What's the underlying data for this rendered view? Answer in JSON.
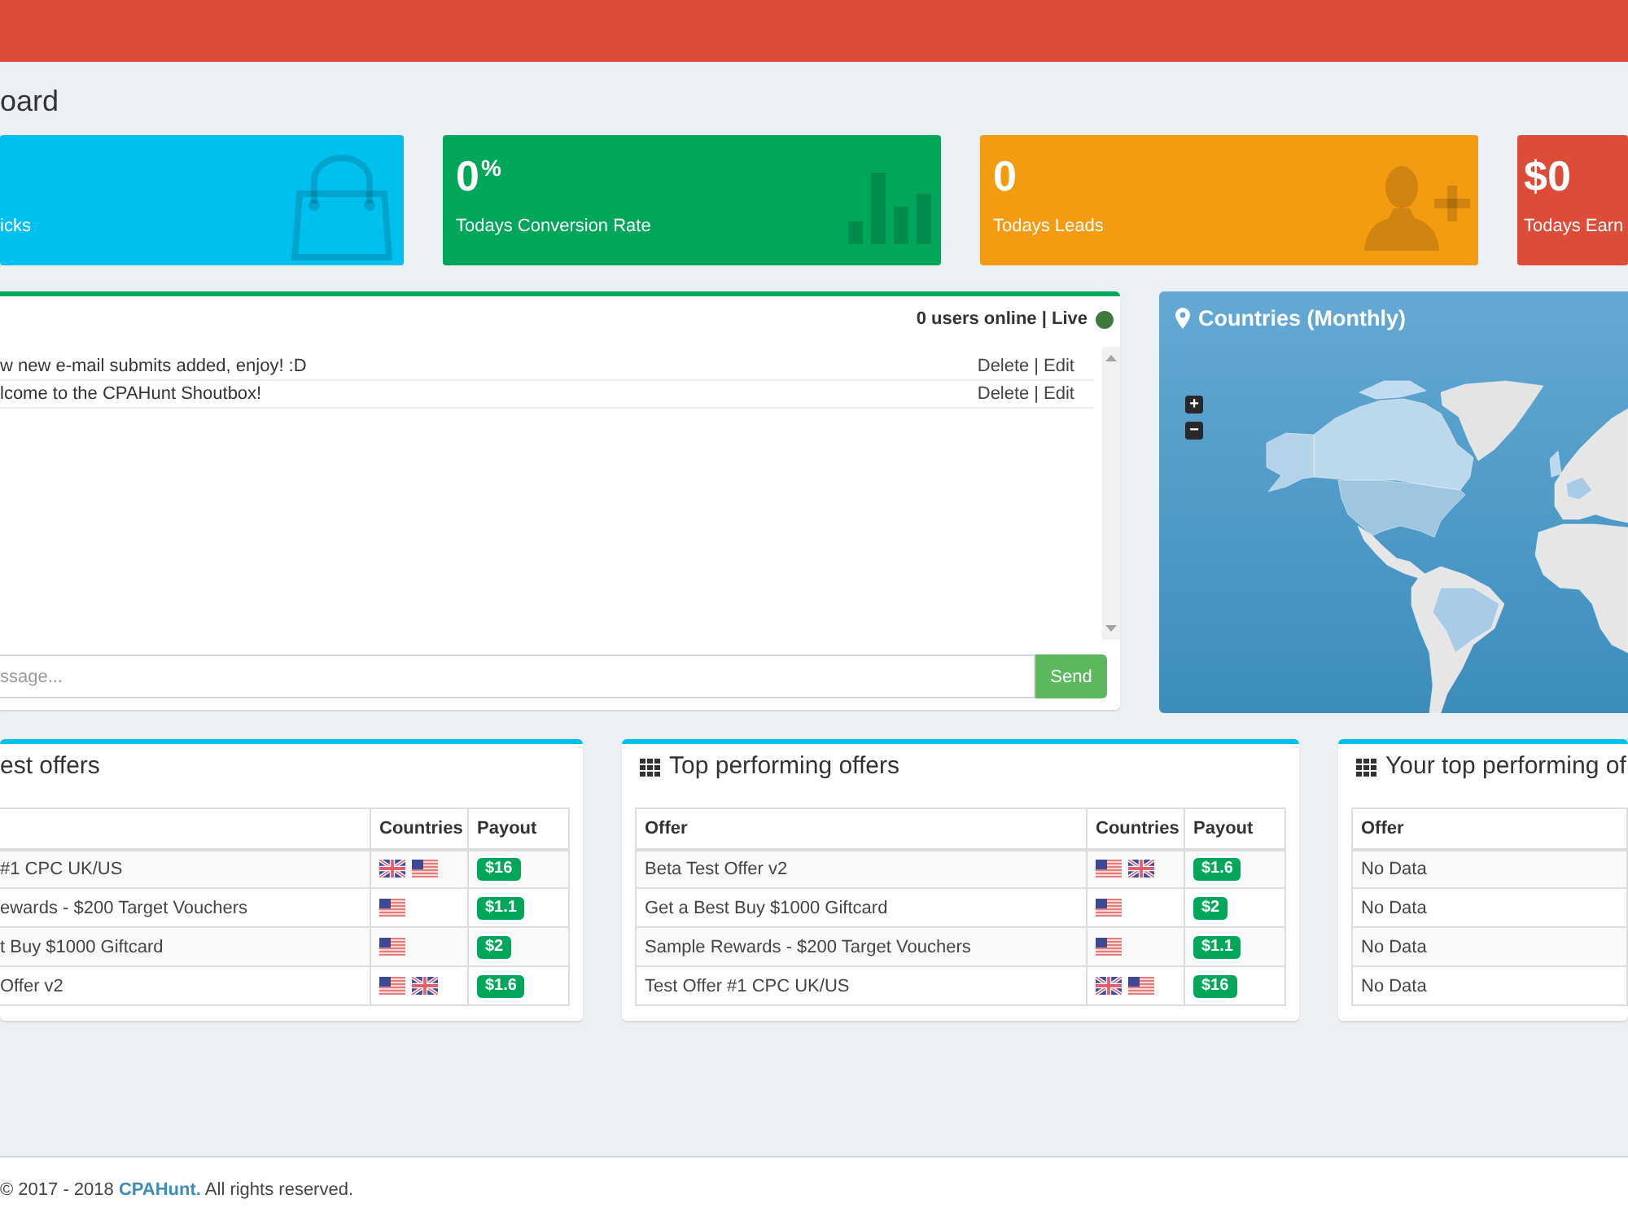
{
  "page_title": "oard",
  "stat_cards": [
    {
      "label": "icks",
      "color": "#00c0ef"
    },
    {
      "value": "0$^{%}$",
      "label": "Todays Conversion Rate",
      "color": "#00a65a"
    },
    {
      "value": "0",
      "label": "Todays Leads",
      "color": "#f39c12"
    },
    {
      "value": "$0",
      "label": "Todays Earn",
      "color": "#dd4b39"
    }
  ],
  "shoutbox": {
    "status": "0 users online | Live",
    "live": true,
    "messages": [
      {
        "text": "w new e-mail submits added, enjoy! :D",
        "delete": "Delete",
        "separator": "|",
        "edit": "Edit"
      },
      {
        "text": "lcome to the CPAHunt Shoutbox!",
        "delete": "Delete",
        "separator": "|",
        "edit": "Edit"
      }
    ],
    "input": {
      "placeholder": "ssage..."
    },
    "send": "Send"
  },
  "map": {
    "title": "Countries (Monthly)",
    "zoom_buttons": [
      "+",
      "−"
    ]
  },
  "offer_panels": [
    {
      "title": "est offers",
      "table": {
        "columns": [
          {
            "kind": "offer"
          },
          {
            "kind": "countries",
            "label": "Countries"
          },
          {
            "kind": "payout",
            "label": "Payout"
          }
        ],
        "rows": [
          {
            "offer": "#1 CPC UK/US",
            "flags": [
              {
                "kind": "uk"
              },
              {
                "kind": "us"
              }
            ],
            "payout": "$16"
          },
          {
            "offer": "ewards - $200 Target Vouchers",
            "flags": [
              {
                "kind": "us"
              }
            ],
            "payout": "$1.1"
          },
          {
            "offer": "t Buy $1000 Giftcard",
            "flags": [
              {
                "kind": "us"
              }
            ],
            "payout": "$2"
          },
          {
            "offer": "Offer v2",
            "flags": [
              {
                "kind": "us"
              },
              {
                "kind": "uk"
              }
            ],
            "payout": "$1.6"
          }
        ]
      }
    },
    {
      "title": "Top performing offers",
      "table": {
        "columns": [
          {
            "kind": "offer",
            "label": "Offer"
          },
          {
            "kind": "countries",
            "label": "Countries"
          },
          {
            "kind": "payout",
            "label": "Payout"
          }
        ],
        "rows": [
          {
            "offer": "Beta Test Offer v2",
            "flags": [
              {
                "kind": "us"
              },
              {
                "kind": "uk"
              }
            ],
            "payout": "$1.6"
          },
          {
            "offer": "Get a Best Buy $1000 Giftcard",
            "flags": [
              {
                "kind": "us"
              }
            ],
            "payout": "$2"
          },
          {
            "offer": "Sample Rewards - $200 Target Vouchers",
            "flags": [
              {
                "kind": "us"
              }
            ],
            "payout": "$1.1"
          },
          {
            "offer": "Test Offer #1 CPC UK/US",
            "flags": [
              {
                "kind": "uk"
              },
              {
                "kind": "us"
              }
            ],
            "payout": "$16"
          }
        ]
      }
    },
    {
      "title": "Your top performing of",
      "table": {
        "columns": [
          {
            "kind": "offer",
            "label": "Offer"
          }
        ],
        "rows": [
          {
            "offer": "No Data"
          },
          {
            "offer": "No Data"
          },
          {
            "offer": "No Data"
          },
          {
            "offer": "No Data"
          }
        ]
      }
    }
  ],
  "footer": {
    "prefix": "© 2017 - 2018",
    "link": "CPAHunt.",
    "suffix": "All rights reserved."
  }
}
